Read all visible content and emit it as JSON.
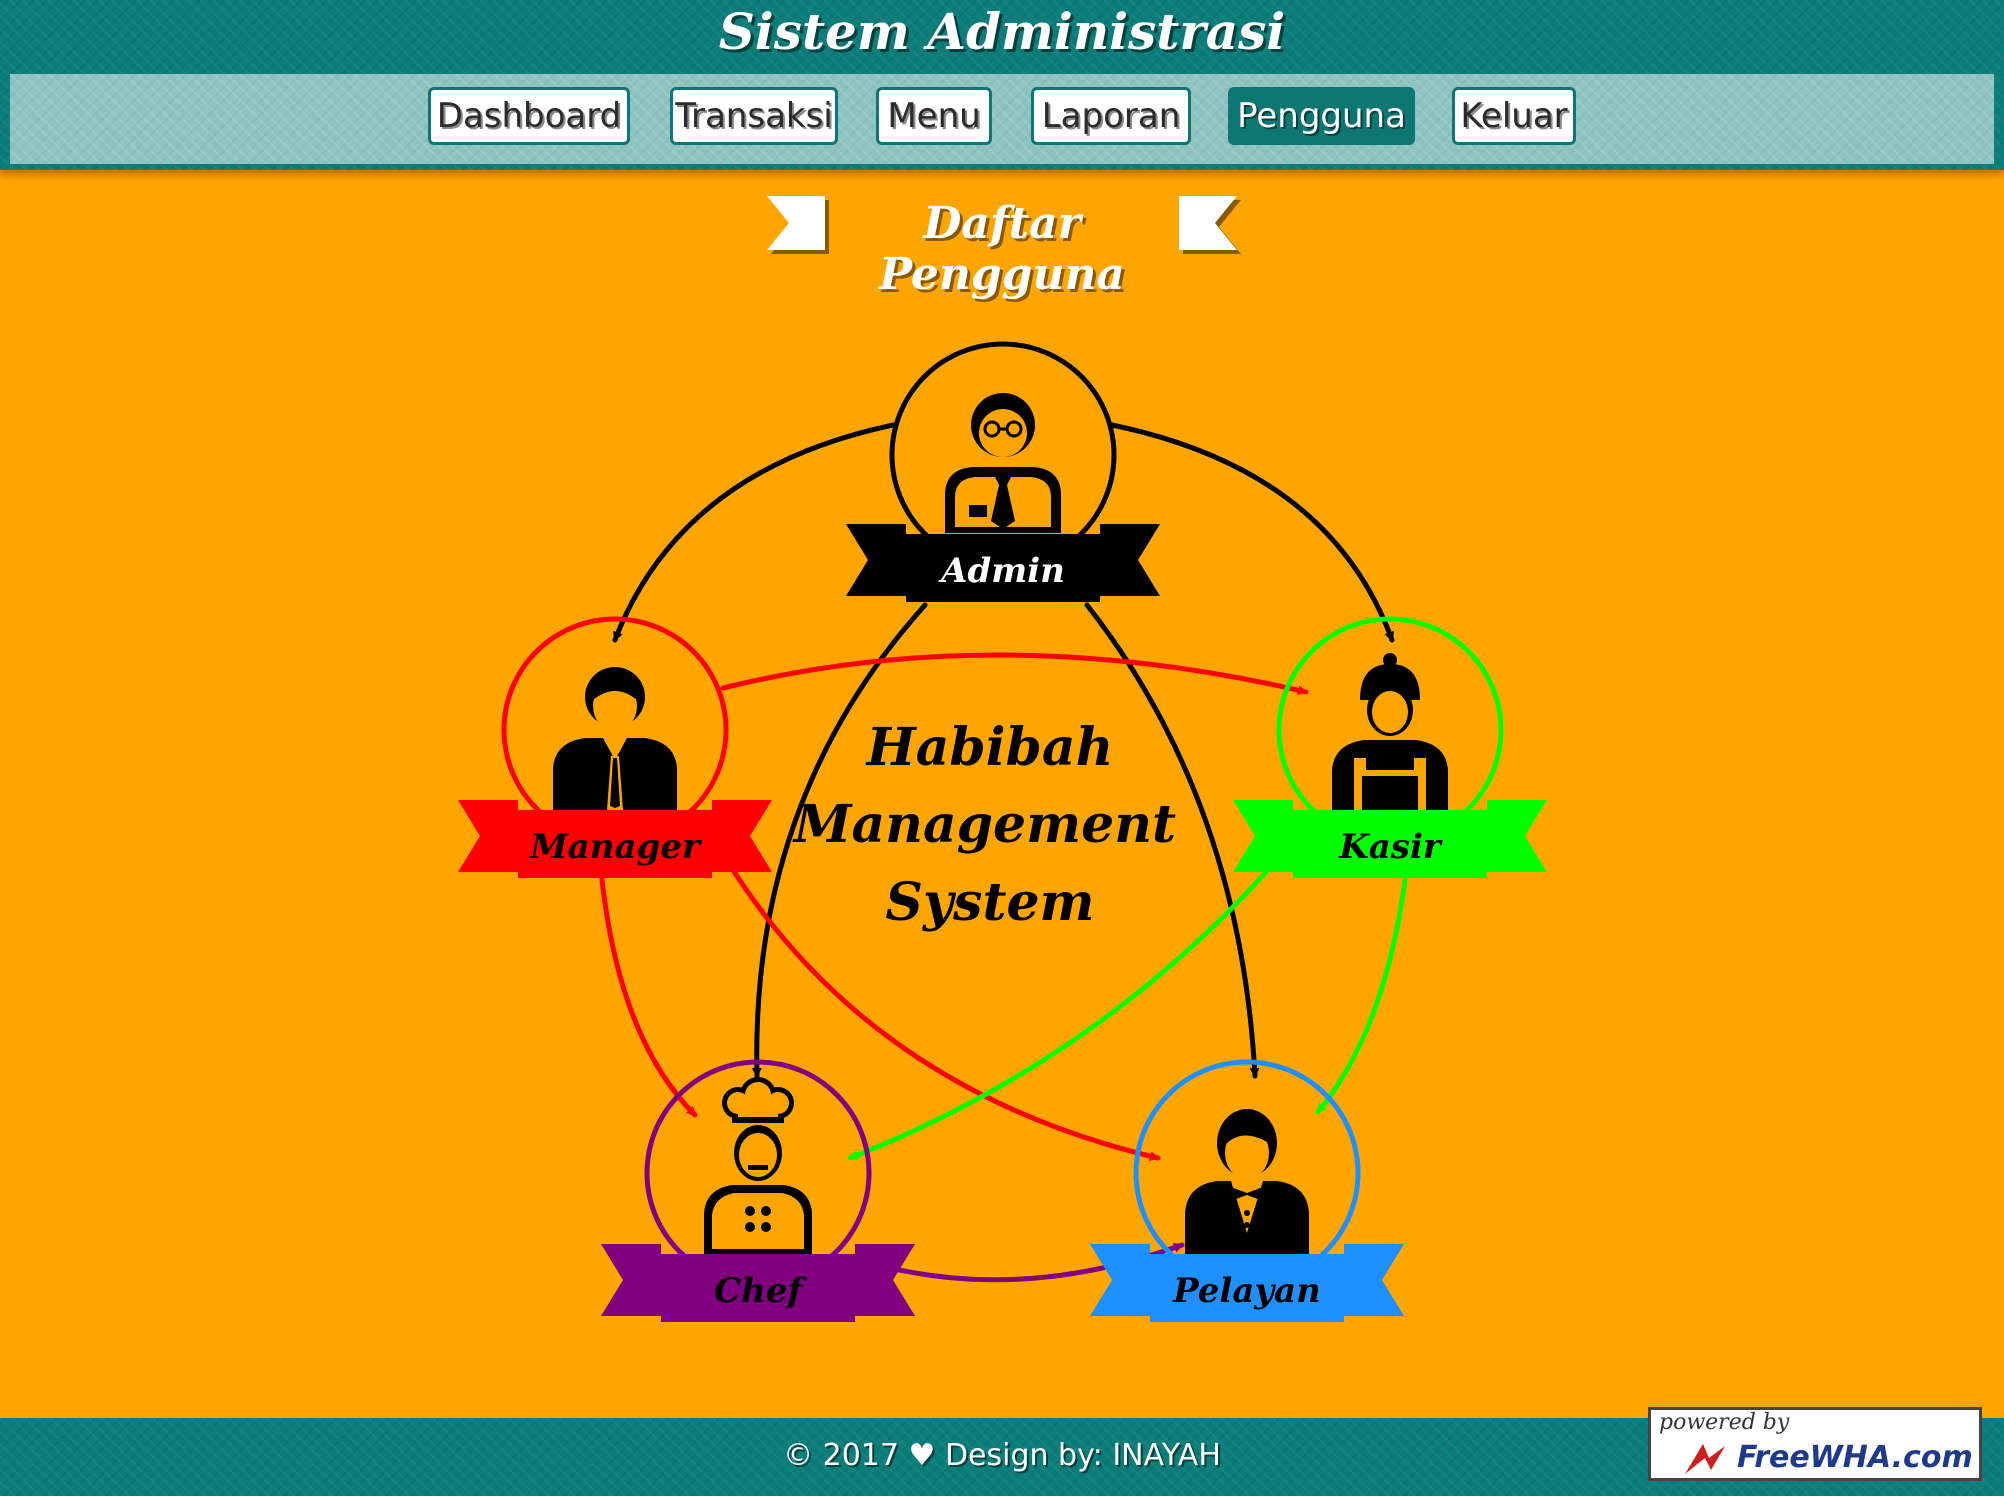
{
  "header": {
    "title": "Sistem Administrasi",
    "nav": [
      {
        "label": "Dashboard",
        "active": false
      },
      {
        "label": "Transaksi",
        "active": false
      },
      {
        "label": "Menu",
        "active": false
      },
      {
        "label": "Laporan",
        "active": false
      },
      {
        "label": "Pengguna",
        "active": true
      },
      {
        "label": "Keluar",
        "active": false
      }
    ]
  },
  "page": {
    "title": "Daftar Pengguna"
  },
  "diagram": {
    "center_text": [
      "Habibah",
      "Management",
      "System"
    ],
    "roles": [
      {
        "label": "Admin",
        "color": "#000000",
        "text_color": "#ffffff",
        "icon": "admin-icon"
      },
      {
        "label": "Manager",
        "color": "#ff0000",
        "text_color": "#000000",
        "icon": "manager-icon"
      },
      {
        "label": "Kasir",
        "color": "#00ff00",
        "text_color": "#000000",
        "icon": "kasir-icon"
      },
      {
        "label": "Chef",
        "color": "#800080",
        "text_color": "#000000",
        "icon": "chef-icon"
      },
      {
        "label": "Pelayan",
        "color": "#1e90ff",
        "text_color": "#000000",
        "icon": "pelayan-icon"
      }
    ]
  },
  "footer": {
    "text": "© 2017 ♥ Design by: INAYAH"
  },
  "badge": {
    "powered_by": "powered by",
    "brand": "FreeWHA.com"
  },
  "colors": {
    "teal": "#0b7d7a",
    "nav_bg": "#8fc3c1",
    "page_bg": "#FFA500"
  }
}
